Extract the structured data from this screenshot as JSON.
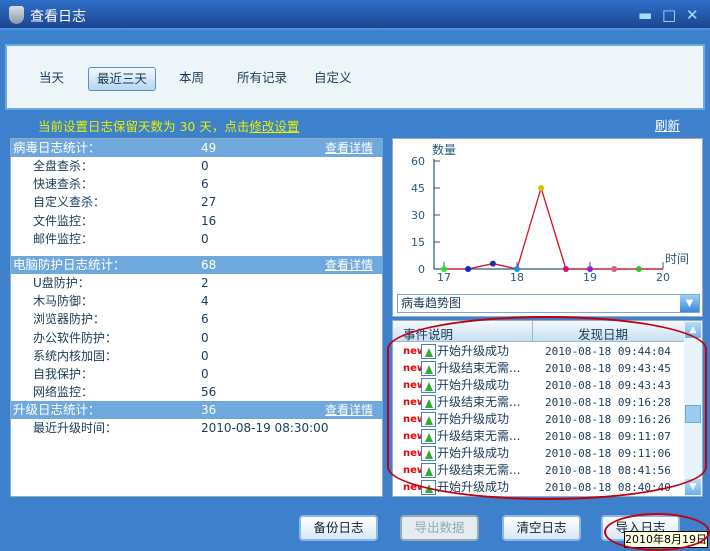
{
  "window": {
    "title": "查看日志",
    "minimize": "▬",
    "maximize": "□",
    "close": "✕"
  },
  "tabs": [
    {
      "label": "当天"
    },
    {
      "label": "最近三天",
      "active": true
    },
    {
      "label": "本周"
    },
    {
      "label": "所有记录"
    },
    {
      "label": "自定义"
    }
  ],
  "info": {
    "text": "当前设置日志保留天数为 30 天，点击",
    "link": "修改设置",
    "refresh": "刷新"
  },
  "stats": {
    "virus": {
      "title": "病毒日志统计：",
      "value": "49",
      "detail": "查看详情",
      "items": [
        {
          "label": "全盘查杀：",
          "value": "0"
        },
        {
          "label": "快速查杀：",
          "value": "6"
        },
        {
          "label": "自定义查杀：",
          "value": "27"
        },
        {
          "label": "文件监控：",
          "value": "16"
        },
        {
          "label": "邮件监控：",
          "value": "0"
        }
      ]
    },
    "protect": {
      "title": "电脑防护日志统计：",
      "value": "68",
      "detail": "查看详情",
      "items": [
        {
          "label": "U盘防护：",
          "value": "2"
        },
        {
          "label": "木马防御：",
          "value": "4"
        },
        {
          "label": "浏览器防护：",
          "value": "6"
        },
        {
          "label": "办公软件防护：",
          "value": "0"
        },
        {
          "label": "系统内核加固：",
          "value": "0"
        },
        {
          "label": "自我保护：",
          "value": "0"
        },
        {
          "label": "网络监控：",
          "value": "56"
        }
      ]
    },
    "upgrade": {
      "title": "升级日志统计：",
      "value": "36",
      "detail": "查看详情",
      "items": [
        {
          "label": "最近升级时间：",
          "value": "2010-08-19 08:30:00"
        }
      ]
    }
  },
  "chart_data": {
    "type": "line",
    "ylabel": "数量",
    "xlabel": "时间",
    "ylim": [
      0,
      60
    ],
    "yticks": [
      "0",
      "15",
      "30",
      "45",
      "60"
    ],
    "xlim": [
      17,
      20
    ],
    "xticks": [
      "17",
      "18",
      "19",
      "20"
    ],
    "line_color": "#d81020",
    "points": [
      {
        "x": 17,
        "y": 0,
        "color": "#30e030"
      },
      {
        "x": 17.33,
        "y": 0,
        "color": "#1020e0"
      },
      {
        "x": 17.67,
        "y": 3,
        "color": "#2a2aa0"
      },
      {
        "x": 18,
        "y": 0,
        "color": "#1090f0"
      },
      {
        "x": 18.33,
        "y": 45,
        "color": "#d8c000"
      },
      {
        "x": 18.67,
        "y": 0,
        "color": "#d0107a"
      },
      {
        "x": 19,
        "y": 0,
        "color": "#9020e0"
      },
      {
        "x": 19.33,
        "y": 0,
        "color": "#d06070"
      },
      {
        "x": 19.67,
        "y": 0,
        "color": "#30c030"
      },
      {
        "x": 20,
        "y": 0
      }
    ]
  },
  "chart_select": "病毒趋势图",
  "list": {
    "headers": [
      "事件说明",
      "发现日期"
    ],
    "badge": "new",
    "rows": [
      {
        "event": "开始升级成功",
        "date": "2010-08-18 09:44:04"
      },
      {
        "event": "升级结束无需...",
        "date": "2010-08-18 09:43:45"
      },
      {
        "event": "开始升级成功",
        "date": "2010-08-18 09:43:43"
      },
      {
        "event": "升级结束无需...",
        "date": "2010-08-18 09:16:28"
      },
      {
        "event": "开始升级成功",
        "date": "2010-08-18 09:16:26"
      },
      {
        "event": "升级结束无需...",
        "date": "2010-08-18 09:11:07"
      },
      {
        "event": "开始升级成功",
        "date": "2010-08-18 09:11:06"
      },
      {
        "event": "升级结束无需...",
        "date": "2010-08-18 08:41:56"
      },
      {
        "event": "开始升级成功",
        "date": "2010-08-18 08:40:40"
      }
    ]
  },
  "buttons": {
    "backup": "备份日志",
    "export": "导出数据",
    "clear": "清空日志",
    "import": "导入日志"
  },
  "tooltip": "2010年8月19日"
}
